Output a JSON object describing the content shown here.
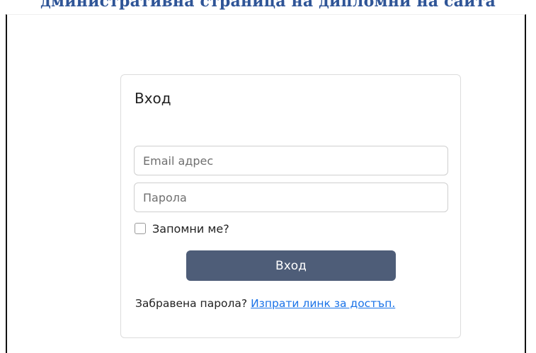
{
  "header": {
    "title": "дминистративна страница на дипломни на сайта"
  },
  "login": {
    "title": "Вход",
    "email_placeholder": "Email адрес",
    "password_placeholder": "Парола",
    "remember_label": "Запомни ме?",
    "submit_label": "Вход",
    "forgot_text": "Забравена парола? ",
    "forgot_link": "Изпрати линк за достъп."
  },
  "colors": {
    "button": "#4e5d78",
    "link": "#1a73e8",
    "header": "#2f5597"
  }
}
